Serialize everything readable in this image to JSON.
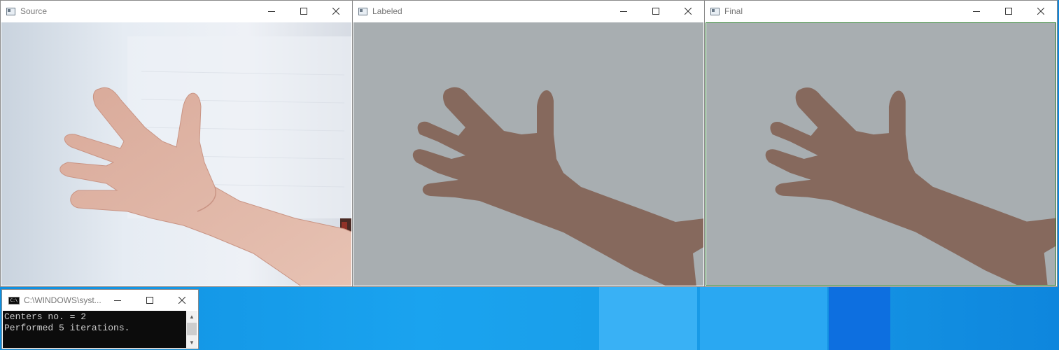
{
  "windows": {
    "source": {
      "title": "Source"
    },
    "labeled": {
      "title": "Labeled"
    },
    "final": {
      "title": "Final"
    },
    "console": {
      "title": "C:\\WINDOWS\\syst...",
      "lines": [
        "Centers no. = 2",
        "Performed 5 iterations."
      ]
    }
  },
  "controls": {
    "minimize": "minimize-icon",
    "maximize": "maximize-icon",
    "close": "close-icon"
  },
  "colors": {
    "segment_background": "#a8aeb1",
    "segment_hand": "#86695d",
    "final_border": "#2e7d32",
    "console_bg": "#0c0c0c",
    "console_text": "#cccccc"
  }
}
